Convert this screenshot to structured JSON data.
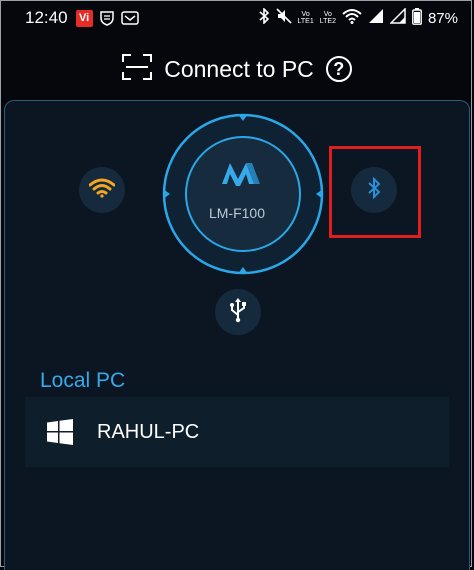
{
  "status_bar": {
    "time": "12:40",
    "vi_label": "Vi",
    "battery": "87%",
    "lte1": "Vo\nLTE1",
    "lte2": "Vo\nLTE2"
  },
  "header": {
    "title": "Connect to PC",
    "help": "?"
  },
  "device": {
    "name": "LM-F100",
    "logo_text": "M"
  },
  "connections": [
    {
      "id": "wifi",
      "icon": "wifi-icon"
    },
    {
      "id": "bluetooth",
      "icon": "bluetooth-icon",
      "highlighted": true
    },
    {
      "id": "usb",
      "icon": "usb-icon"
    }
  ],
  "local_pc": {
    "section_title": "Local PC",
    "items": [
      {
        "name": "RAHUL-PC",
        "icon": "windows-icon"
      }
    ]
  },
  "colors": {
    "accent": "#37a9ea",
    "wifi": "#f5a623",
    "bluetooth": "#2b8fd8",
    "highlight": "#e01e1e",
    "panel_bg": "#0b1622"
  }
}
